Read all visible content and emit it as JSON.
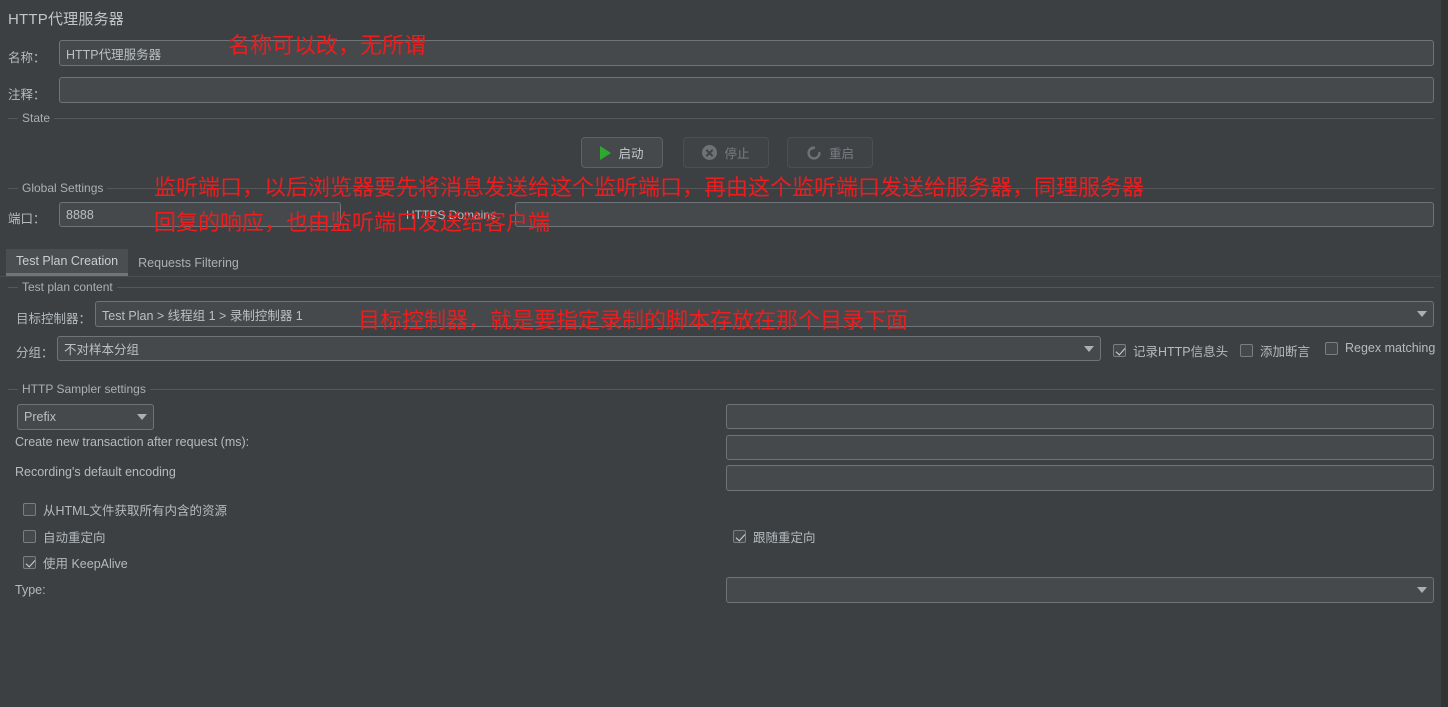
{
  "window": {
    "title": "HTTP代理服务器"
  },
  "header": {
    "name_label": "名称：",
    "name_value": "HTTP代理服务器",
    "comment_label": "注释：",
    "comment_value": ""
  },
  "state_group": {
    "title": "State",
    "buttons": [
      {
        "label": "启动",
        "icon": "play-icon",
        "enabled": true
      },
      {
        "label": "停止",
        "icon": "stop-icon",
        "enabled": false
      },
      {
        "label": "重启",
        "icon": "restart-icon",
        "enabled": false
      }
    ]
  },
  "global_settings": {
    "title": "Global Settings",
    "port_label": "端口：",
    "port_value": "8888",
    "https_domains_label": "HTTPS Domains",
    "https_domains_value": ""
  },
  "tabs": [
    {
      "label": "Test Plan Creation",
      "active": true
    },
    {
      "label": "Requests Filtering",
      "active": false
    }
  ],
  "test_plan_content": {
    "title": "Test plan content",
    "target_controller_label": "目标控制器：",
    "target_controller_value": "Test Plan > 线程组 1 > 录制控制器 1",
    "grouping_label": "分组：",
    "grouping_value": "不对样本分组",
    "checkboxes": [
      {
        "label": "记录HTTP信息头",
        "checked": true
      },
      {
        "label": "添加断言",
        "checked": false
      },
      {
        "label": "Regex matching",
        "checked": false
      }
    ]
  },
  "sampler_settings": {
    "title": "HTTP Sampler settings",
    "naming_mode_value": "Prefix",
    "prefix_value": "",
    "transaction_label": "Create new transaction after request (ms):",
    "transaction_value": "",
    "encoding_label": "Recording's default encoding",
    "encoding_value": "",
    "checkboxes_left": [
      {
        "label": "从HTML文件获取所有内含的资源",
        "checked": false
      },
      {
        "label": "自动重定向",
        "checked": false
      },
      {
        "label": "使用 KeepAlive",
        "checked": true
      }
    ],
    "checkboxes_right": [
      {
        "label": "跟随重定向",
        "checked": true
      }
    ],
    "type_label": "Type:",
    "type_value": ""
  },
  "annotations": [
    {
      "text": "名称可以改，无所谓"
    },
    {
      "text": "监听端口，以后浏览器要先将消息发送给这个监听端口，再由这个监听端口发送给服务器，同理服务器"
    },
    {
      "text": "回复的响应，也由监听端口发送给客户端"
    },
    {
      "text": "目标控制器，就是要指定录制的脚本存放在那个目录下面"
    }
  ],
  "colors": {
    "panel_bg": "#3c4043",
    "field_bg": "#45494c",
    "border": "#6e7478",
    "text": "#b4bbc0",
    "annotation_red": "#ee1c1c",
    "play_green": "#2fa82f"
  }
}
